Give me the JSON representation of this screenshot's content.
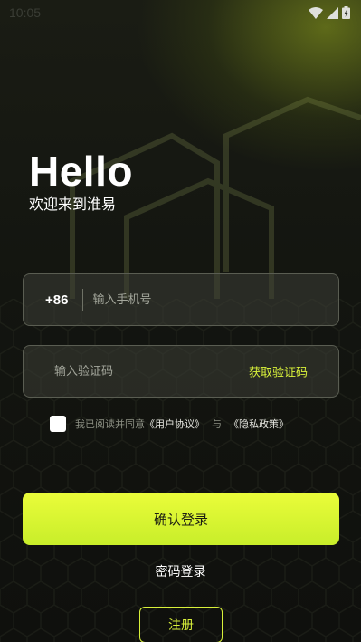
{
  "status_bar": {
    "time": "10:05"
  },
  "header": {
    "title": "Hello",
    "subtitle": "欢迎来到淮易"
  },
  "phone": {
    "prefix": "+86",
    "placeholder": "输入手机号"
  },
  "code": {
    "placeholder": "输入验证码",
    "get_code_label": "获取验证码"
  },
  "agreement": {
    "text": "我已阅读并同意",
    "user_agreement": "《用户协议》",
    "and": "与",
    "privacy_policy": "《隐私政策》"
  },
  "actions": {
    "login_label": "确认登录",
    "password_login_label": "密码登录",
    "register_label": "注册"
  },
  "colors": {
    "accent": "#d8f03a",
    "button_gradient_top": "#eafc3a",
    "button_gradient_bottom": "#c8ee2a",
    "background": "#121410"
  },
  "icons": [
    "wifi-icon",
    "cellular-signal-icon",
    "battery-icon"
  ]
}
